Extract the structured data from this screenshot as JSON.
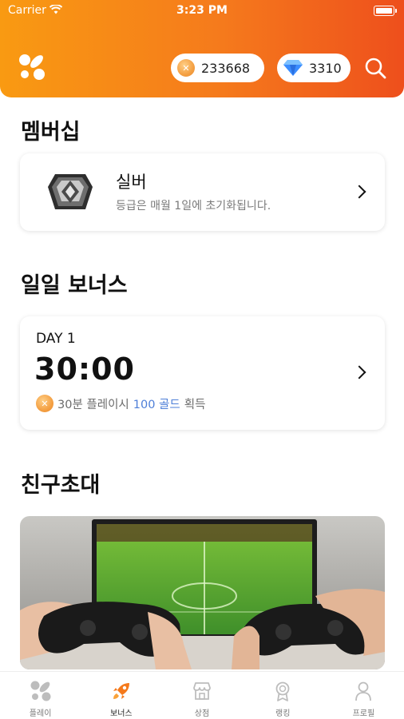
{
  "status_bar": {
    "carrier": "Carrier",
    "time": "3:23 PM"
  },
  "header": {
    "gold_amount": "233668",
    "gem_amount": "3310"
  },
  "membership": {
    "title": "멤버십",
    "tier_name": "실버",
    "tier_desc": "등급은 매월 1일에 초기화됩니다."
  },
  "daily_bonus": {
    "title": "일일 보너스",
    "day": "DAY 1",
    "timer": "30:00",
    "text_before": "30분 플레이시",
    "highlight": "100 골드",
    "text_after": "획득"
  },
  "invite": {
    "title": "친구초대"
  },
  "tabs": [
    {
      "label": "플레이",
      "icon": "play-logo-icon",
      "active": false
    },
    {
      "label": "보너스",
      "icon": "rocket-icon",
      "active": true
    },
    {
      "label": "상점",
      "icon": "shop-icon",
      "active": false
    },
    {
      "label": "랭킹",
      "icon": "medal-icon",
      "active": false
    },
    {
      "label": "프로필",
      "icon": "person-icon",
      "active": false
    }
  ],
  "colors": {
    "accent": "#f57a1c",
    "accent_dark": "#ee4f1c",
    "link": "#4e7fd8"
  }
}
